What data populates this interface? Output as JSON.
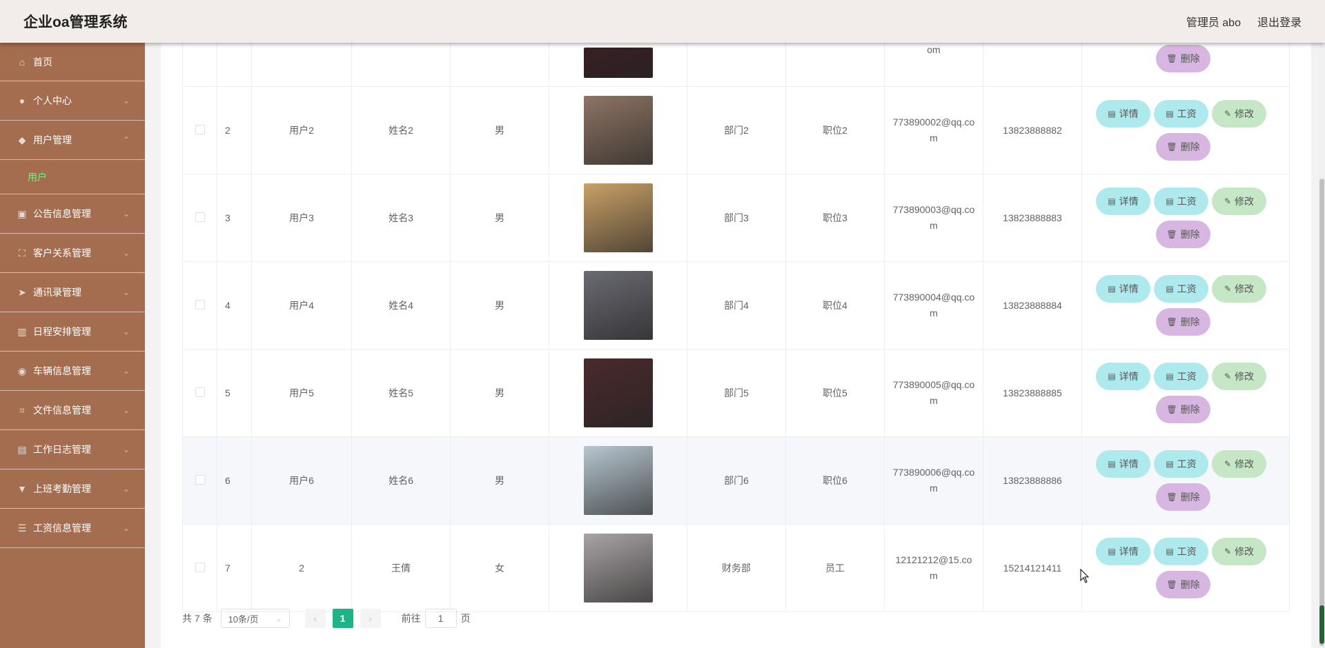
{
  "header": {
    "title": "企业oa管理系统",
    "user_label": "管理员 abo",
    "logout_label": "退出登录"
  },
  "sidebar": {
    "items": [
      {
        "label": "首页",
        "icon": "home-icon"
      },
      {
        "label": "个人中心",
        "icon": "person-icon"
      },
      {
        "label": "用户管理",
        "icon": "shield-icon",
        "expanded": true
      },
      {
        "label": "公告信息管理",
        "icon": "copy-icon"
      },
      {
        "label": "客户关系管理",
        "icon": "scan-icon"
      },
      {
        "label": "通讯录管理",
        "icon": "send-icon"
      },
      {
        "label": "日程安排管理",
        "icon": "chart-icon"
      },
      {
        "label": "车辆信息管理",
        "icon": "mic-icon"
      },
      {
        "label": "文件信息管理",
        "icon": "crop-icon"
      },
      {
        "label": "工作日志管理",
        "icon": "clipboard-icon"
      },
      {
        "label": "上班考勤管理",
        "icon": "stamp-icon"
      },
      {
        "label": "工资信息管理",
        "icon": "sliders-icon"
      }
    ],
    "sub_item": "用户"
  },
  "table": {
    "rows": [
      {
        "idx": "",
        "username": "",
        "name": "",
        "gender": "",
        "dept": "",
        "position": "",
        "email": "om",
        "phone": "",
        "avatar_color": "#3a1f24",
        "partial": true
      },
      {
        "idx": "2",
        "username": "用户2",
        "name": "姓名2",
        "gender": "男",
        "dept": "部门2",
        "position": "职位2",
        "email": "773890002@qq.com",
        "phone": "13823888882",
        "avatar_color": "#8d7464"
      },
      {
        "idx": "3",
        "username": "用户3",
        "name": "姓名3",
        "gender": "男",
        "dept": "部门3",
        "position": "职位3",
        "email": "773890003@qq.com",
        "phone": "13823888883",
        "avatar_color": "#c9a067"
      },
      {
        "idx": "4",
        "username": "用户4",
        "name": "姓名4",
        "gender": "男",
        "dept": "部门4",
        "position": "职位4",
        "email": "773890004@qq.com",
        "phone": "13823888884",
        "avatar_color": "#6a6a72"
      },
      {
        "idx": "5",
        "username": "用户5",
        "name": "姓名5",
        "gender": "男",
        "dept": "部门5",
        "position": "职位5",
        "email": "773890005@qq.com",
        "phone": "13823888885",
        "avatar_color": "#4a2a2c"
      },
      {
        "idx": "6",
        "username": "用户6",
        "name": "姓名6",
        "gender": "男",
        "dept": "部门6",
        "position": "职位6",
        "email": "773890006@qq.com",
        "phone": "13823888886",
        "avatar_color": "#b7c6cf",
        "highlight": true
      },
      {
        "idx": "7",
        "username": "2",
        "name": "王倩",
        "gender": "女",
        "dept": "财务部",
        "position": "员工",
        "email": "12121212@15.com",
        "phone": "15214121411",
        "avatar_color": "#a9a3a4"
      }
    ],
    "buttons": {
      "detail": "详情",
      "salary": "工资",
      "edit": "修改",
      "delete": "删除"
    }
  },
  "pagination": {
    "total_label": "共 7 条",
    "page_size": "10条/页",
    "current_page": "1",
    "goto_label": "前往",
    "goto_value": "1",
    "page_suffix": "页",
    "prev": "‹",
    "next": "›"
  }
}
